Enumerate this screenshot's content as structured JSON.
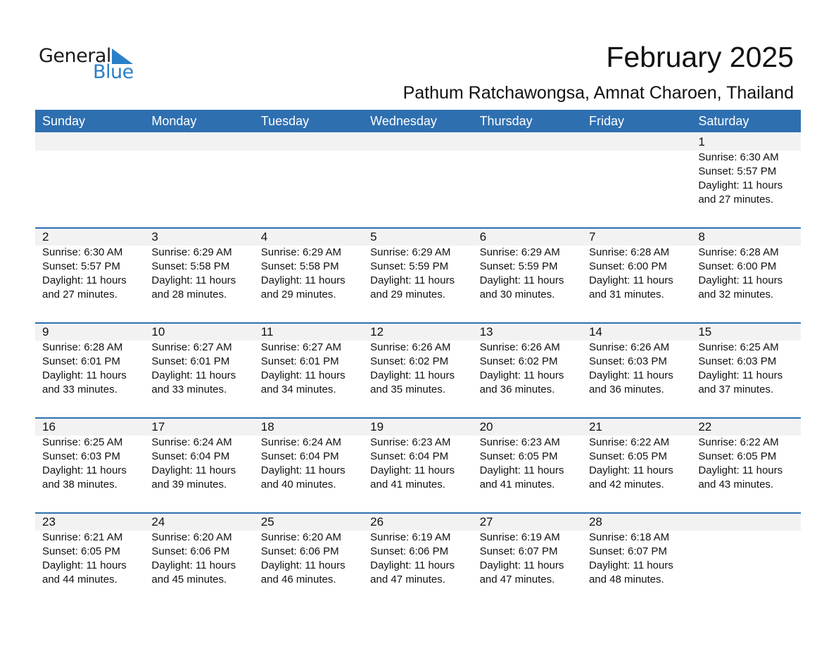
{
  "logo": {
    "line1": "General",
    "line2": "Blue",
    "icon": "triangle-flag-icon",
    "accent": "#2a7fc9"
  },
  "header": {
    "title": "February 2025",
    "subtitle": "Pathum Ratchawongsa, Amnat Charoen, Thailand"
  },
  "colors": {
    "header_bg": "#2e6fb0",
    "band_bg": "#f2f2f2"
  },
  "weekdays": [
    "Sunday",
    "Monday",
    "Tuesday",
    "Wednesday",
    "Thursday",
    "Friday",
    "Saturday"
  ],
  "weeks": [
    [
      null,
      null,
      null,
      null,
      null,
      null,
      {
        "day": "1",
        "sunrise": "Sunrise: 6:30 AM",
        "sunset": "Sunset: 5:57 PM",
        "daylight1": "Daylight: 11 hours",
        "daylight2": "and 27 minutes."
      }
    ],
    [
      {
        "day": "2",
        "sunrise": "Sunrise: 6:30 AM",
        "sunset": "Sunset: 5:57 PM",
        "daylight1": "Daylight: 11 hours",
        "daylight2": "and 27 minutes."
      },
      {
        "day": "3",
        "sunrise": "Sunrise: 6:29 AM",
        "sunset": "Sunset: 5:58 PM",
        "daylight1": "Daylight: 11 hours",
        "daylight2": "and 28 minutes."
      },
      {
        "day": "4",
        "sunrise": "Sunrise: 6:29 AM",
        "sunset": "Sunset: 5:58 PM",
        "daylight1": "Daylight: 11 hours",
        "daylight2": "and 29 minutes."
      },
      {
        "day": "5",
        "sunrise": "Sunrise: 6:29 AM",
        "sunset": "Sunset: 5:59 PM",
        "daylight1": "Daylight: 11 hours",
        "daylight2": "and 29 minutes."
      },
      {
        "day": "6",
        "sunrise": "Sunrise: 6:29 AM",
        "sunset": "Sunset: 5:59 PM",
        "daylight1": "Daylight: 11 hours",
        "daylight2": "and 30 minutes."
      },
      {
        "day": "7",
        "sunrise": "Sunrise: 6:28 AM",
        "sunset": "Sunset: 6:00 PM",
        "daylight1": "Daylight: 11 hours",
        "daylight2": "and 31 minutes."
      },
      {
        "day": "8",
        "sunrise": "Sunrise: 6:28 AM",
        "sunset": "Sunset: 6:00 PM",
        "daylight1": "Daylight: 11 hours",
        "daylight2": "and 32 minutes."
      }
    ],
    [
      {
        "day": "9",
        "sunrise": "Sunrise: 6:28 AM",
        "sunset": "Sunset: 6:01 PM",
        "daylight1": "Daylight: 11 hours",
        "daylight2": "and 33 minutes."
      },
      {
        "day": "10",
        "sunrise": "Sunrise: 6:27 AM",
        "sunset": "Sunset: 6:01 PM",
        "daylight1": "Daylight: 11 hours",
        "daylight2": "and 33 minutes."
      },
      {
        "day": "11",
        "sunrise": "Sunrise: 6:27 AM",
        "sunset": "Sunset: 6:01 PM",
        "daylight1": "Daylight: 11 hours",
        "daylight2": "and 34 minutes."
      },
      {
        "day": "12",
        "sunrise": "Sunrise: 6:26 AM",
        "sunset": "Sunset: 6:02 PM",
        "daylight1": "Daylight: 11 hours",
        "daylight2": "and 35 minutes."
      },
      {
        "day": "13",
        "sunrise": "Sunrise: 6:26 AM",
        "sunset": "Sunset: 6:02 PM",
        "daylight1": "Daylight: 11 hours",
        "daylight2": "and 36 minutes."
      },
      {
        "day": "14",
        "sunrise": "Sunrise: 6:26 AM",
        "sunset": "Sunset: 6:03 PM",
        "daylight1": "Daylight: 11 hours",
        "daylight2": "and 36 minutes."
      },
      {
        "day": "15",
        "sunrise": "Sunrise: 6:25 AM",
        "sunset": "Sunset: 6:03 PM",
        "daylight1": "Daylight: 11 hours",
        "daylight2": "and 37 minutes."
      }
    ],
    [
      {
        "day": "16",
        "sunrise": "Sunrise: 6:25 AM",
        "sunset": "Sunset: 6:03 PM",
        "daylight1": "Daylight: 11 hours",
        "daylight2": "and 38 minutes."
      },
      {
        "day": "17",
        "sunrise": "Sunrise: 6:24 AM",
        "sunset": "Sunset: 6:04 PM",
        "daylight1": "Daylight: 11 hours",
        "daylight2": "and 39 minutes."
      },
      {
        "day": "18",
        "sunrise": "Sunrise: 6:24 AM",
        "sunset": "Sunset: 6:04 PM",
        "daylight1": "Daylight: 11 hours",
        "daylight2": "and 40 minutes."
      },
      {
        "day": "19",
        "sunrise": "Sunrise: 6:23 AM",
        "sunset": "Sunset: 6:04 PM",
        "daylight1": "Daylight: 11 hours",
        "daylight2": "and 41 minutes."
      },
      {
        "day": "20",
        "sunrise": "Sunrise: 6:23 AM",
        "sunset": "Sunset: 6:05 PM",
        "daylight1": "Daylight: 11 hours",
        "daylight2": "and 41 minutes."
      },
      {
        "day": "21",
        "sunrise": "Sunrise: 6:22 AM",
        "sunset": "Sunset: 6:05 PM",
        "daylight1": "Daylight: 11 hours",
        "daylight2": "and 42 minutes."
      },
      {
        "day": "22",
        "sunrise": "Sunrise: 6:22 AM",
        "sunset": "Sunset: 6:05 PM",
        "daylight1": "Daylight: 11 hours",
        "daylight2": "and 43 minutes."
      }
    ],
    [
      {
        "day": "23",
        "sunrise": "Sunrise: 6:21 AM",
        "sunset": "Sunset: 6:05 PM",
        "daylight1": "Daylight: 11 hours",
        "daylight2": "and 44 minutes."
      },
      {
        "day": "24",
        "sunrise": "Sunrise: 6:20 AM",
        "sunset": "Sunset: 6:06 PM",
        "daylight1": "Daylight: 11 hours",
        "daylight2": "and 45 minutes."
      },
      {
        "day": "25",
        "sunrise": "Sunrise: 6:20 AM",
        "sunset": "Sunset: 6:06 PM",
        "daylight1": "Daylight: 11 hours",
        "daylight2": "and 46 minutes."
      },
      {
        "day": "26",
        "sunrise": "Sunrise: 6:19 AM",
        "sunset": "Sunset: 6:06 PM",
        "daylight1": "Daylight: 11 hours",
        "daylight2": "and 47 minutes."
      },
      {
        "day": "27",
        "sunrise": "Sunrise: 6:19 AM",
        "sunset": "Sunset: 6:07 PM",
        "daylight1": "Daylight: 11 hours",
        "daylight2": "and 47 minutes."
      },
      {
        "day": "28",
        "sunrise": "Sunrise: 6:18 AM",
        "sunset": "Sunset: 6:07 PM",
        "daylight1": "Daylight: 11 hours",
        "daylight2": "and 48 minutes."
      },
      null
    ]
  ]
}
